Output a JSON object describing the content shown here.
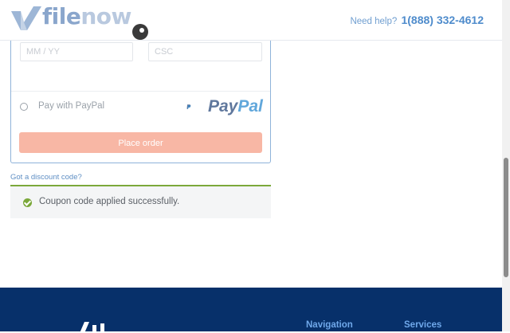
{
  "header": {
    "brand_file": "file",
    "brand_now": "now",
    "help_label": "Need help?",
    "phone": "1(888) 332-4612"
  },
  "payment": {
    "date_placeholder": "MM / YY",
    "csc_placeholder": "CSC",
    "paypal_option_label": "Pay with PayPal",
    "paypal_brand_pay": "Pay",
    "paypal_brand_pal": "Pal",
    "place_order_label": "Place order"
  },
  "discount": {
    "link_label": "Got a discount code?",
    "success_message": "Coupon code applied successfully."
  },
  "footer": {
    "nav_heading": "Navigation",
    "services_heading": "Services"
  },
  "colors": {
    "accent_blue": "#4f8ccc",
    "place_order_bg": "#f8b7a5",
    "success_green": "#7ba83a",
    "footer_bg": "#07306a"
  }
}
